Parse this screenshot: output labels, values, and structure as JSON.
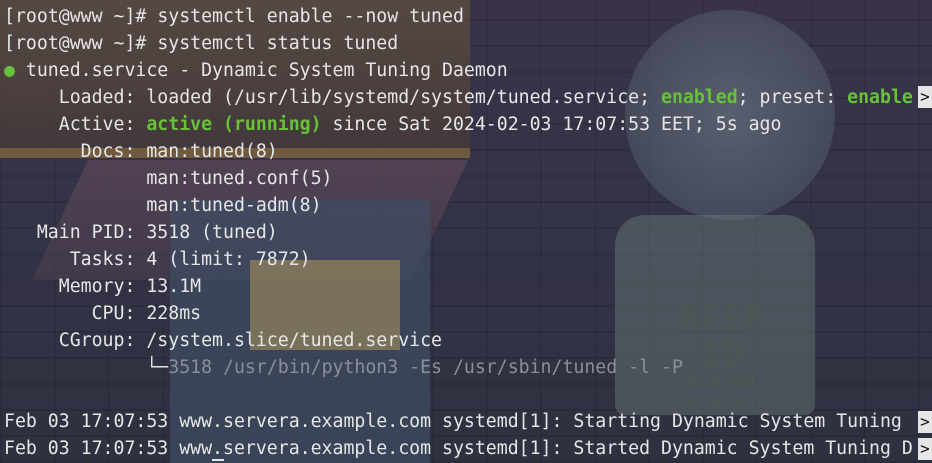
{
  "terminal": {
    "lines": [
      {
        "prompt": "[root@www ~]# ",
        "cmd": "systemctl enable --now tuned"
      },
      {
        "prompt": "[root@www ~]# ",
        "cmd": "systemctl status tuned"
      }
    ],
    "status": {
      "bullet": "●",
      "header": " tuned.service - Dynamic System Tuning Daemon",
      "loaded_label": "     Loaded: ",
      "loaded_value_a": "loaded (/usr/lib/systemd/system/tuned.service; ",
      "loaded_enabled": "enabled",
      "loaded_value_b": "; preset: ",
      "loaded_preset": "enable",
      "active_label": "     Active: ",
      "active_state": "active (running)",
      "active_since": " since Sat 2024-02-03 17:07:53 EET; 5s ago",
      "docs_label": "       Docs: ",
      "docs": [
        "man:tuned(8)",
        "man:tuned.conf(5)",
        "man:tuned-adm(8)"
      ],
      "docs_indent": "             ",
      "mainpid_label": "   Main PID: ",
      "mainpid_value": "3518 (tuned)",
      "tasks_label": "      Tasks: ",
      "tasks_value": "4 (limit: 7872)",
      "memory_label": "     Memory: ",
      "memory_value": "13.1M",
      "cpu_label": "        CPU: ",
      "cpu_value": "228ms",
      "cgroup_label": "     CGroup: ",
      "cgroup_value": "/system.slice/tuned.service",
      "cgroup_child_indent": "             ",
      "cgroup_child_branch": "└─",
      "cgroup_child_value": "3518 /usr/bin/python3 -Es /usr/sbin/tuned -l -P"
    },
    "log": [
      "Feb 03 17:07:53 www.servera.example.com systemd[1]: Starting Dynamic System Tuning ",
      "Feb 03 17:07:53 www.servera.example.com systemd[1]: Started Dynamic System Tuning D"
    ],
    "truncation_marker": ">"
  },
  "wallpaper": {
    "sign_line1": "KEEP ID",
    "sign_line2": "RANDOM",
    "sign_line3": "CHECKS"
  },
  "colors": {
    "green": "#67c23a",
    "text": "#e6e6e6"
  }
}
